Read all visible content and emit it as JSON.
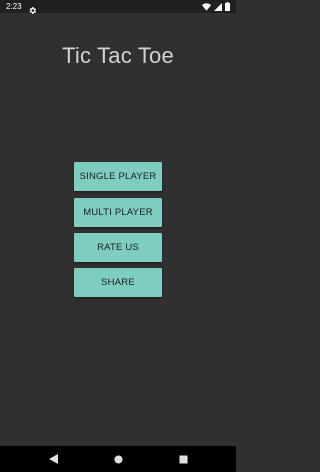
{
  "status_bar": {
    "time": "2:23",
    "icons": [
      "settings-icon",
      "wifi-icon",
      "signal-icon",
      "battery-icon"
    ]
  },
  "app": {
    "title": "Tic Tac Toe"
  },
  "menu": {
    "single_player": "SINGLE PLAYER",
    "multi_player": "MULTI PLAYER",
    "rate_us": "RATE US",
    "share": "SHARE"
  },
  "navigation": {
    "icons": [
      "back-icon",
      "home-icon",
      "recents-icon"
    ]
  },
  "colors": {
    "background": "#303030",
    "button": "#7fcdc1",
    "title_text": "#d2d2d2",
    "button_text": "#1d1d1d"
  }
}
